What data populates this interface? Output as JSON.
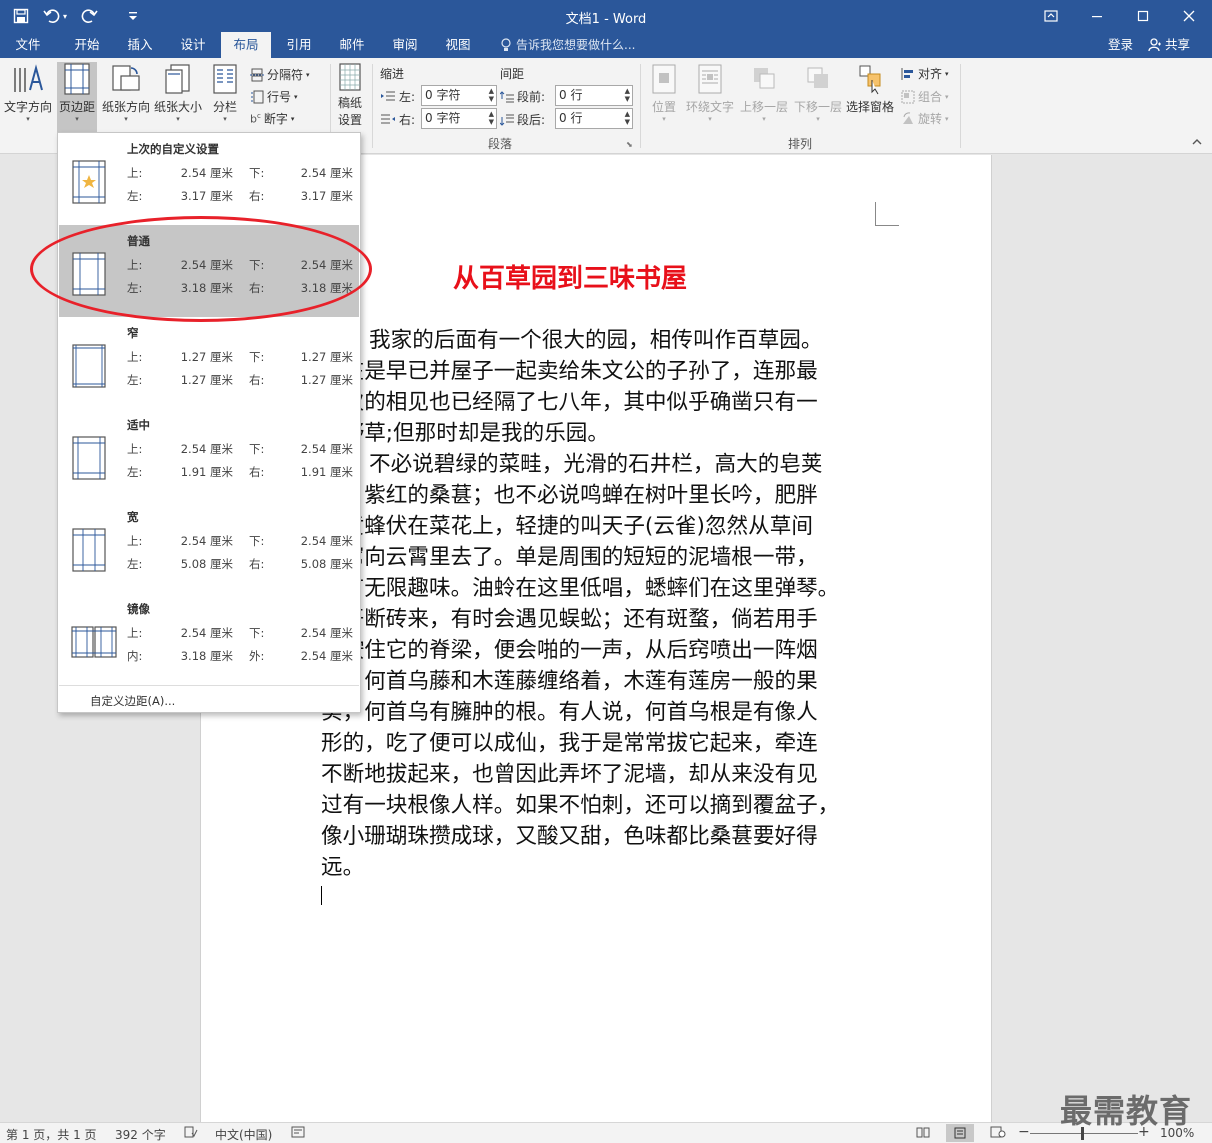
{
  "window": {
    "title": "文档1 - Word"
  },
  "qat": {
    "save": "save-icon",
    "undo": "undo-icon",
    "redo": "redo-icon",
    "customize": "customize-qat-icon"
  },
  "tabs": [
    {
      "label": "文件"
    },
    {
      "label": "开始"
    },
    {
      "label": "插入"
    },
    {
      "label": "设计"
    },
    {
      "label": "布局"
    },
    {
      "label": "引用"
    },
    {
      "label": "邮件"
    },
    {
      "label": "审阅"
    },
    {
      "label": "视图"
    }
  ],
  "tell_me": "告诉我您想要做什么...",
  "account": {
    "login": "登录",
    "share": "共享"
  },
  "ribbon": {
    "page_setup": {
      "text_direction": "文字方向",
      "margins": "页边距",
      "orientation": "纸张方向",
      "size": "纸张大小",
      "columns": "分栏",
      "breaks": "分隔符",
      "line_numbers": "行号",
      "hyphenation": "断字"
    },
    "manuscript": {
      "label1": "稿纸",
      "label2": "设置"
    },
    "paragraph": {
      "indent": "缩进",
      "spacing": "间距",
      "left_label": "左:",
      "left_value": "0 字符",
      "right_label": "右:",
      "right_value": "0 字符",
      "before_label": "段前:",
      "before_value": "0 行",
      "after_label": "段后:",
      "after_value": "0 行",
      "group_label": "段落"
    },
    "arrange": {
      "position": "位置",
      "wrap_text": "环绕文字",
      "bring_forward": "上移一层",
      "send_backward": "下移一层",
      "selection_pane": "选择窗格",
      "align": "对齐",
      "group": "组合",
      "rotate": "旋转",
      "group_label": "排列"
    }
  },
  "margins_menu": {
    "options": [
      {
        "name": "上次的自定义设置",
        "l1": "上:",
        "v1": "2.54 厘米",
        "l2": "下:",
        "v2": "2.54 厘米",
        "l3": "左:",
        "v3": "3.17 厘米",
        "l4": "右:",
        "v4": "3.17 厘米"
      },
      {
        "name": "普通",
        "l1": "上:",
        "v1": "2.54 厘米",
        "l2": "下:",
        "v2": "2.54 厘米",
        "l3": "左:",
        "v3": "3.18 厘米",
        "l4": "右:",
        "v4": "3.18 厘米"
      },
      {
        "name": "窄",
        "l1": "上:",
        "v1": "1.27 厘米",
        "l2": "下:",
        "v2": "1.27 厘米",
        "l3": "左:",
        "v3": "1.27 厘米",
        "l4": "右:",
        "v4": "1.27 厘米"
      },
      {
        "name": "适中",
        "l1": "上:",
        "v1": "2.54 厘米",
        "l2": "下:",
        "v2": "2.54 厘米",
        "l3": "左:",
        "v3": "1.91 厘米",
        "l4": "右:",
        "v4": "1.91 厘米"
      },
      {
        "name": "宽",
        "l1": "上:",
        "v1": "2.54 厘米",
        "l2": "下:",
        "v2": "2.54 厘米",
        "l3": "左:",
        "v3": "5.08 厘米",
        "l4": "右:",
        "v4": "5.08 厘米"
      },
      {
        "name": "镜像",
        "l1": "上:",
        "v1": "2.54 厘米",
        "l2": "下:",
        "v2": "2.54 厘米",
        "l3": "内:",
        "v3": "3.18 厘米",
        "l4": "外:",
        "v4": "2.54 厘米"
      }
    ],
    "custom": "自定义边距(A)..."
  },
  "document": {
    "title": "从百草园到三味书屋",
    "lines": [
      "我家的后面有一个很大的园，相传叫作百草园。",
      "现在是早已并屋子一起卖给朱文公的子孙了，连那最",
      "末次的相见也已经隔了七八年，其中似乎确凿只有一",
      "些野草;但那时却是我的乐园。",
      "不必说碧绿的菜畦，光滑的石井栏，高大的皂荚",
      "树，紫红的桑葚；也不必说鸣蝉在树叶里长吟，肥胖",
      "的黄蜂伏在菜花上，轻捷的叫天子(云雀)忽然从草间",
      "直窜向云霄里去了。单是周围的短短的泥墙根一带，",
      "就有无限趣味。油蛉在这里低唱，蟋蟀们在这里弹琴。",
      "翻开断砖来，有时会遇见蜈蚣；还有斑蝥，倘若用手",
      "指按住它的脊梁，便会啪的一声，从后窍喷出一阵烟",
      "雾。何首乌藤和木莲藤缠络着，木莲有莲房一般的果",
      "实，何首乌有臃肿的根。有人说，何首乌根是有像人",
      "形的，吃了便可以成仙，我于是常常拔它起来，牵连",
      "不断地拔起来，也曾因此弄坏了泥墙，却从来没有见",
      "过有一块根像人样。如果不怕刺，还可以摘到覆盆子，",
      "像小珊瑚珠攒成球，又酸又甜，色味都比桑葚要好得",
      "远。"
    ]
  },
  "status": {
    "page": "第 1 页，共 1 页",
    "words": "392 个字",
    "language": "中文(中国)",
    "zoom": "100%"
  },
  "watermark": "最需教育",
  "colors": {
    "accent": "#2b579a",
    "title_red": "#e8101a",
    "highlight_circle": "#e8212a"
  }
}
